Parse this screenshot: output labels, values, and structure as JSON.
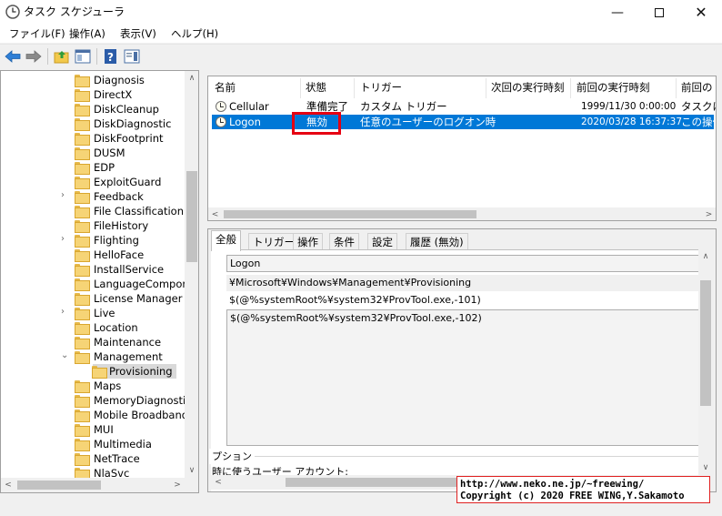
{
  "window": {
    "title": "タスク スケジューラ"
  },
  "menu": [
    "ファイル(F)",
    "操作(A)",
    "表示(V)",
    "ヘルプ(H)"
  ],
  "tree": {
    "items": [
      {
        "label": "Diagnosis",
        "expand": ""
      },
      {
        "label": "DirectX",
        "expand": ""
      },
      {
        "label": "DiskCleanup",
        "expand": ""
      },
      {
        "label": "DiskDiagnostic",
        "expand": ""
      },
      {
        "label": "DiskFootprint",
        "expand": ""
      },
      {
        "label": "DUSM",
        "expand": ""
      },
      {
        "label": "EDP",
        "expand": ""
      },
      {
        "label": "ExploitGuard",
        "expand": ""
      },
      {
        "label": "Feedback",
        "expand": ">"
      },
      {
        "label": "File Classification I",
        "expand": ""
      },
      {
        "label": "FileHistory",
        "expand": ""
      },
      {
        "label": "Flighting",
        "expand": ">"
      },
      {
        "label": "HelloFace",
        "expand": ""
      },
      {
        "label": "InstallService",
        "expand": ""
      },
      {
        "label": "LanguageComponer",
        "expand": ""
      },
      {
        "label": "License Manager",
        "expand": ""
      },
      {
        "label": "Live",
        "expand": ">"
      },
      {
        "label": "Location",
        "expand": ""
      },
      {
        "label": "Maintenance",
        "expand": ""
      },
      {
        "label": "Management",
        "expand": "v"
      },
      {
        "label": "Provisioning",
        "expand": "",
        "child": true,
        "selected": true
      },
      {
        "label": "Maps",
        "expand": ""
      },
      {
        "label": "MemoryDiagnostic",
        "expand": ""
      },
      {
        "label": "Mobile Broadband A",
        "expand": ""
      },
      {
        "label": "MUI",
        "expand": ""
      },
      {
        "label": "Multimedia",
        "expand": ""
      },
      {
        "label": "NetTrace",
        "expand": ""
      },
      {
        "label": "NlaSvc",
        "expand": ""
      }
    ]
  },
  "tasklist": {
    "columns": [
      "名前",
      "状態",
      "トリガー",
      "次回の実行時刻",
      "前回の実行時刻",
      "前回の"
    ],
    "rows": [
      {
        "name": "Cellular",
        "status": "準備完了",
        "trigger": "カスタム トリガー",
        "next": "",
        "last": "1999/11/30 0:00:00",
        "result": "タスクは"
      },
      {
        "name": "Logon",
        "status": "無効",
        "trigger": "任意のユーザーのログオン時",
        "next": "",
        "last": "2020/03/28 16:37:37",
        "result": "この操作"
      }
    ]
  },
  "tabs": [
    "全般",
    "トリガー",
    "操作",
    "条件",
    "設定",
    "履歴 (無効)"
  ],
  "general": {
    "name": "Logon",
    "location": "¥Microsoft¥Windows¥Management¥Provisioning",
    "author": "$(@%systemRoot%¥system32¥ProvTool.exe,-101)",
    "description": "$(@%systemRoot%¥system32¥ProvTool.exe,-102)",
    "options_label": "プション",
    "account_label": "時に使うユーザー アカウント:"
  },
  "watermark": {
    "line1": "http://www.neko.ne.jp/~freewing/",
    "line2": "Copyright (c) 2020 FREE WING,Y.Sakamoto"
  },
  "colors": {
    "selection": "#0078d7",
    "highlight": "#e60012"
  }
}
